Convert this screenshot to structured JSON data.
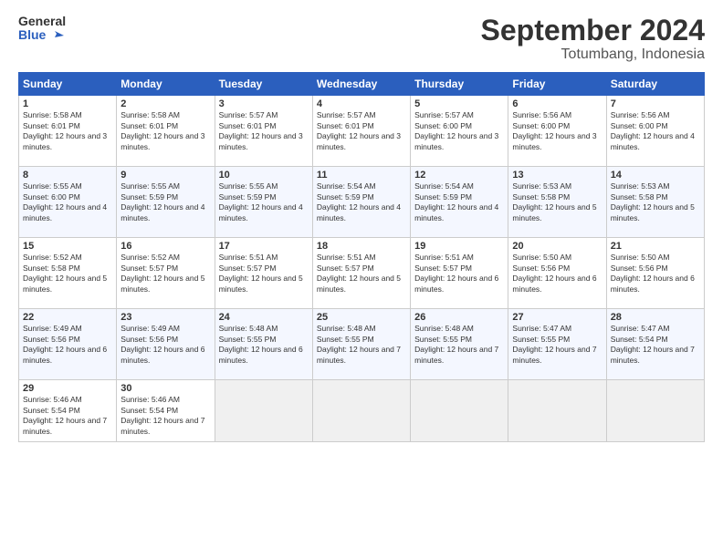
{
  "header": {
    "logo_line1": "General",
    "logo_line2": "Blue",
    "month_title": "September 2024",
    "subtitle": "Totumbang, Indonesia"
  },
  "weekdays": [
    "Sunday",
    "Monday",
    "Tuesday",
    "Wednesday",
    "Thursday",
    "Friday",
    "Saturday"
  ],
  "weeks": [
    [
      {
        "day": "1",
        "sunrise": "Sunrise: 5:58 AM",
        "sunset": "Sunset: 6:01 PM",
        "daylight": "Daylight: 12 hours and 3 minutes."
      },
      {
        "day": "2",
        "sunrise": "Sunrise: 5:58 AM",
        "sunset": "Sunset: 6:01 PM",
        "daylight": "Daylight: 12 hours and 3 minutes."
      },
      {
        "day": "3",
        "sunrise": "Sunrise: 5:57 AM",
        "sunset": "Sunset: 6:01 PM",
        "daylight": "Daylight: 12 hours and 3 minutes."
      },
      {
        "day": "4",
        "sunrise": "Sunrise: 5:57 AM",
        "sunset": "Sunset: 6:01 PM",
        "daylight": "Daylight: 12 hours and 3 minutes."
      },
      {
        "day": "5",
        "sunrise": "Sunrise: 5:57 AM",
        "sunset": "Sunset: 6:00 PM",
        "daylight": "Daylight: 12 hours and 3 minutes."
      },
      {
        "day": "6",
        "sunrise": "Sunrise: 5:56 AM",
        "sunset": "Sunset: 6:00 PM",
        "daylight": "Daylight: 12 hours and 3 minutes."
      },
      {
        "day": "7",
        "sunrise": "Sunrise: 5:56 AM",
        "sunset": "Sunset: 6:00 PM",
        "daylight": "Daylight: 12 hours and 4 minutes."
      }
    ],
    [
      {
        "day": "8",
        "sunrise": "Sunrise: 5:55 AM",
        "sunset": "Sunset: 6:00 PM",
        "daylight": "Daylight: 12 hours and 4 minutes."
      },
      {
        "day": "9",
        "sunrise": "Sunrise: 5:55 AM",
        "sunset": "Sunset: 5:59 PM",
        "daylight": "Daylight: 12 hours and 4 minutes."
      },
      {
        "day": "10",
        "sunrise": "Sunrise: 5:55 AM",
        "sunset": "Sunset: 5:59 PM",
        "daylight": "Daylight: 12 hours and 4 minutes."
      },
      {
        "day": "11",
        "sunrise": "Sunrise: 5:54 AM",
        "sunset": "Sunset: 5:59 PM",
        "daylight": "Daylight: 12 hours and 4 minutes."
      },
      {
        "day": "12",
        "sunrise": "Sunrise: 5:54 AM",
        "sunset": "Sunset: 5:59 PM",
        "daylight": "Daylight: 12 hours and 4 minutes."
      },
      {
        "day": "13",
        "sunrise": "Sunrise: 5:53 AM",
        "sunset": "Sunset: 5:58 PM",
        "daylight": "Daylight: 12 hours and 5 minutes."
      },
      {
        "day": "14",
        "sunrise": "Sunrise: 5:53 AM",
        "sunset": "Sunset: 5:58 PM",
        "daylight": "Daylight: 12 hours and 5 minutes."
      }
    ],
    [
      {
        "day": "15",
        "sunrise": "Sunrise: 5:52 AM",
        "sunset": "Sunset: 5:58 PM",
        "daylight": "Daylight: 12 hours and 5 minutes."
      },
      {
        "day": "16",
        "sunrise": "Sunrise: 5:52 AM",
        "sunset": "Sunset: 5:57 PM",
        "daylight": "Daylight: 12 hours and 5 minutes."
      },
      {
        "day": "17",
        "sunrise": "Sunrise: 5:51 AM",
        "sunset": "Sunset: 5:57 PM",
        "daylight": "Daylight: 12 hours and 5 minutes."
      },
      {
        "day": "18",
        "sunrise": "Sunrise: 5:51 AM",
        "sunset": "Sunset: 5:57 PM",
        "daylight": "Daylight: 12 hours and 5 minutes."
      },
      {
        "day": "19",
        "sunrise": "Sunrise: 5:51 AM",
        "sunset": "Sunset: 5:57 PM",
        "daylight": "Daylight: 12 hours and 6 minutes."
      },
      {
        "day": "20",
        "sunrise": "Sunrise: 5:50 AM",
        "sunset": "Sunset: 5:56 PM",
        "daylight": "Daylight: 12 hours and 6 minutes."
      },
      {
        "day": "21",
        "sunrise": "Sunrise: 5:50 AM",
        "sunset": "Sunset: 5:56 PM",
        "daylight": "Daylight: 12 hours and 6 minutes."
      }
    ],
    [
      {
        "day": "22",
        "sunrise": "Sunrise: 5:49 AM",
        "sunset": "Sunset: 5:56 PM",
        "daylight": "Daylight: 12 hours and 6 minutes."
      },
      {
        "day": "23",
        "sunrise": "Sunrise: 5:49 AM",
        "sunset": "Sunset: 5:56 PM",
        "daylight": "Daylight: 12 hours and 6 minutes."
      },
      {
        "day": "24",
        "sunrise": "Sunrise: 5:48 AM",
        "sunset": "Sunset: 5:55 PM",
        "daylight": "Daylight: 12 hours and 6 minutes."
      },
      {
        "day": "25",
        "sunrise": "Sunrise: 5:48 AM",
        "sunset": "Sunset: 5:55 PM",
        "daylight": "Daylight: 12 hours and 7 minutes."
      },
      {
        "day": "26",
        "sunrise": "Sunrise: 5:48 AM",
        "sunset": "Sunset: 5:55 PM",
        "daylight": "Daylight: 12 hours and 7 minutes."
      },
      {
        "day": "27",
        "sunrise": "Sunrise: 5:47 AM",
        "sunset": "Sunset: 5:55 PM",
        "daylight": "Daylight: 12 hours and 7 minutes."
      },
      {
        "day": "28",
        "sunrise": "Sunrise: 5:47 AM",
        "sunset": "Sunset: 5:54 PM",
        "daylight": "Daylight: 12 hours and 7 minutes."
      }
    ],
    [
      {
        "day": "29",
        "sunrise": "Sunrise: 5:46 AM",
        "sunset": "Sunset: 5:54 PM",
        "daylight": "Daylight: 12 hours and 7 minutes."
      },
      {
        "day": "30",
        "sunrise": "Sunrise: 5:46 AM",
        "sunset": "Sunset: 5:54 PM",
        "daylight": "Daylight: 12 hours and 7 minutes."
      },
      {
        "day": "",
        "sunrise": "",
        "sunset": "",
        "daylight": ""
      },
      {
        "day": "",
        "sunrise": "",
        "sunset": "",
        "daylight": ""
      },
      {
        "day": "",
        "sunrise": "",
        "sunset": "",
        "daylight": ""
      },
      {
        "day": "",
        "sunrise": "",
        "sunset": "",
        "daylight": ""
      },
      {
        "day": "",
        "sunrise": "",
        "sunset": "",
        "daylight": ""
      }
    ]
  ]
}
